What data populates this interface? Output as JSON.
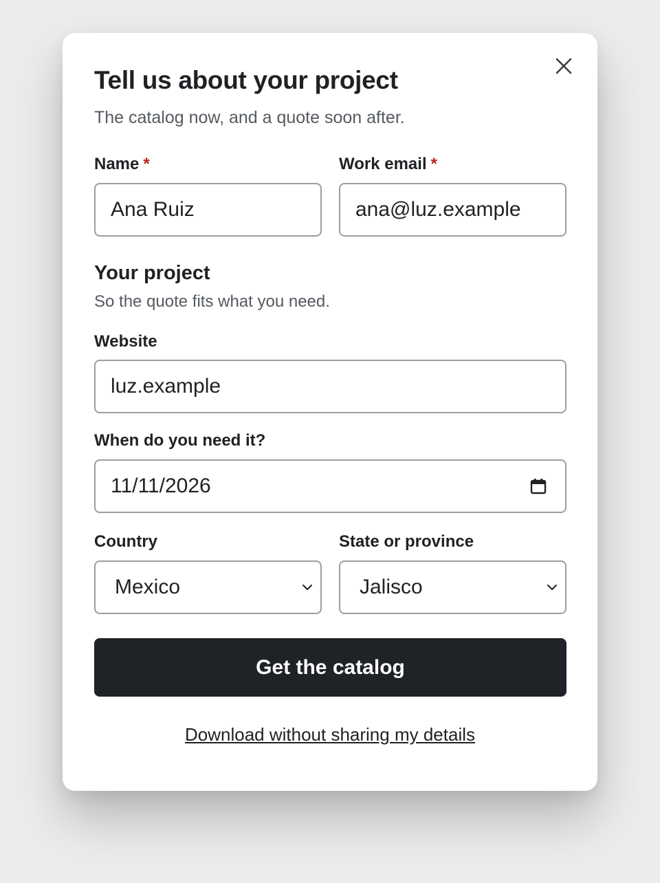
{
  "dialog": {
    "title": "Tell us about your project",
    "subtitle": "The catalog now, and a quote soon after.",
    "close_icon": "close-icon"
  },
  "fields": {
    "name": {
      "label": "Name",
      "required_mark": "*",
      "value": "Ana Ruiz"
    },
    "work_email": {
      "label": "Work email",
      "required_mark": "*",
      "value": "ana@luz.example"
    }
  },
  "project": {
    "heading": "Your project",
    "description": "So the quote fits what you need.",
    "website": {
      "label": "Website",
      "value": "luz.example"
    },
    "need_date": {
      "label": "When do you need it?",
      "value": "11/11/2026",
      "icon": "calendar-icon"
    },
    "country": {
      "label": "Country",
      "selected": "Mexico",
      "icon": "chevron-down-icon"
    },
    "state": {
      "label": "State or province",
      "selected": "Jalisco",
      "icon": "chevron-down-icon"
    }
  },
  "actions": {
    "submit_label": "Get the catalog",
    "skip_link": "Download without sharing my details"
  },
  "colors": {
    "background": "#ececec",
    "card": "#ffffff",
    "primary_button": "#1f2328",
    "required": "#b3261e",
    "border": "#9a9ea3"
  }
}
